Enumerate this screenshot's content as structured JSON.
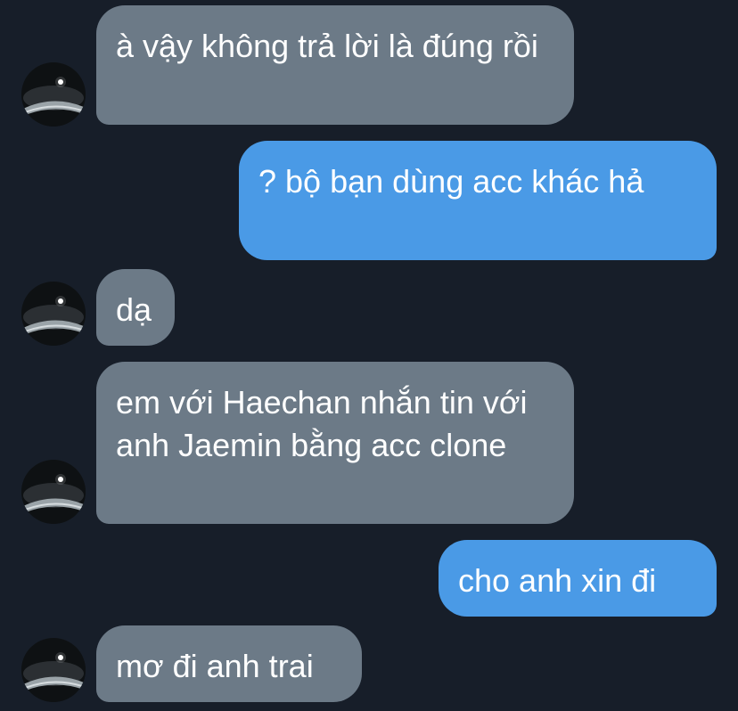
{
  "conversation": {
    "messages": [
      {
        "sender": "other",
        "text": "à vậy không trả lời là đúng rồi"
      },
      {
        "sender": "me",
        "text": "? bộ bạn dùng acc khác hả"
      },
      {
        "sender": "other",
        "text": "dạ"
      },
      {
        "sender": "other",
        "text": "em với Haechan nhắn tin với anh Jaemin bằng acc clone"
      },
      {
        "sender": "me",
        "text": "cho anh xin đi"
      },
      {
        "sender": "other",
        "text": "mơ đi anh trai"
      }
    ]
  },
  "colors": {
    "background": "#171e29",
    "incoming_bubble": "#6c7a87",
    "outgoing_bubble": "#4a9ae6",
    "text": "#ffffff"
  },
  "icons": {
    "avatar": "avatar-icon"
  }
}
